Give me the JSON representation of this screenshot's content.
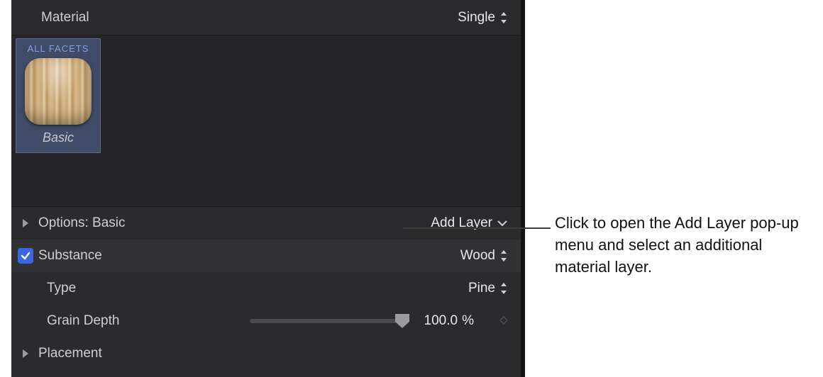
{
  "header": {
    "material_label": "Material",
    "material_value": "Single"
  },
  "facets": {
    "tab_title": "ALL FACETS",
    "swatch_label": "Basic"
  },
  "options": {
    "label": "Options: Basic",
    "add_layer_label": "Add Layer"
  },
  "substance": {
    "label": "Substance",
    "value": "Wood",
    "checked": true
  },
  "type": {
    "label": "Type",
    "value": "Pine"
  },
  "grain_depth": {
    "label": "Grain Depth",
    "value": "100.0",
    "unit": "%"
  },
  "placement": {
    "label": "Placement"
  },
  "callout": {
    "text": "Click to open the Add Layer pop-up menu and select an additional material layer."
  }
}
